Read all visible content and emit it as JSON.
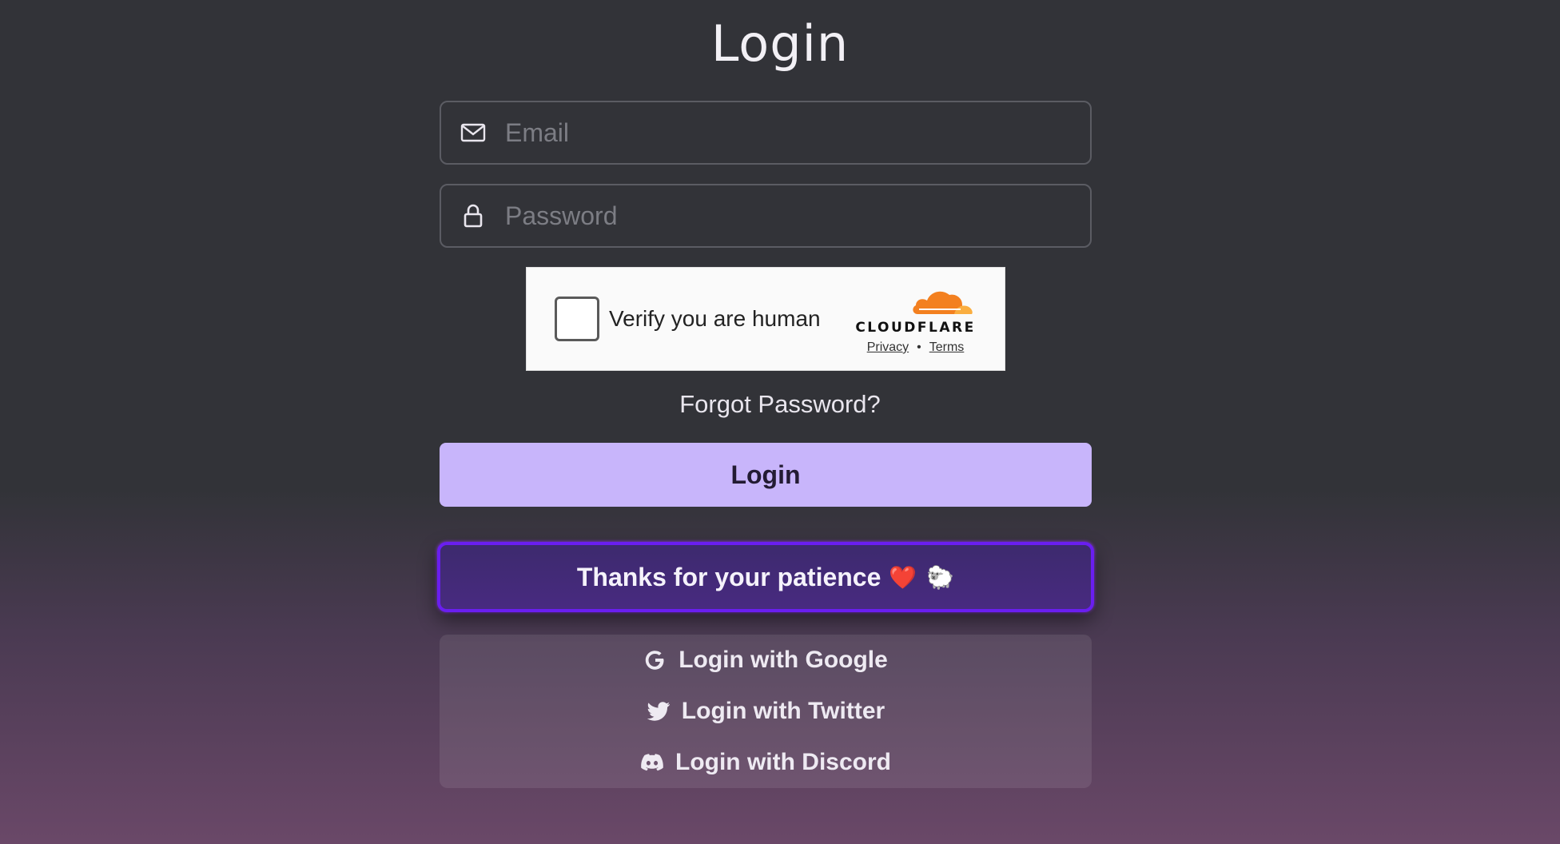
{
  "page": {
    "title": "Login"
  },
  "form": {
    "email": {
      "placeholder": "Email",
      "value": "",
      "icon": "mail-icon"
    },
    "password": {
      "placeholder": "Password",
      "value": "",
      "icon": "lock-icon"
    }
  },
  "captcha": {
    "label": "Verify you are human",
    "brand": "CLOUDFLARE",
    "privacy": "Privacy",
    "separator": "•",
    "terms": "Terms",
    "brand_color": "#f38020"
  },
  "forgot_password": "Forgot Password?",
  "login_button": "Login",
  "banner": {
    "text": "Thanks for your patience",
    "heart": "❤️",
    "sheep": "🐑"
  },
  "social": [
    {
      "label": "Login with Google",
      "icon": "google-icon"
    },
    {
      "label": "Login with Twitter",
      "icon": "twitter-icon"
    },
    {
      "label": "Login with Discord",
      "icon": "discord-icon"
    }
  ],
  "colors": {
    "accent": "#c8b5fb",
    "banner_border": "#6a1ef0",
    "background": "#323338"
  }
}
